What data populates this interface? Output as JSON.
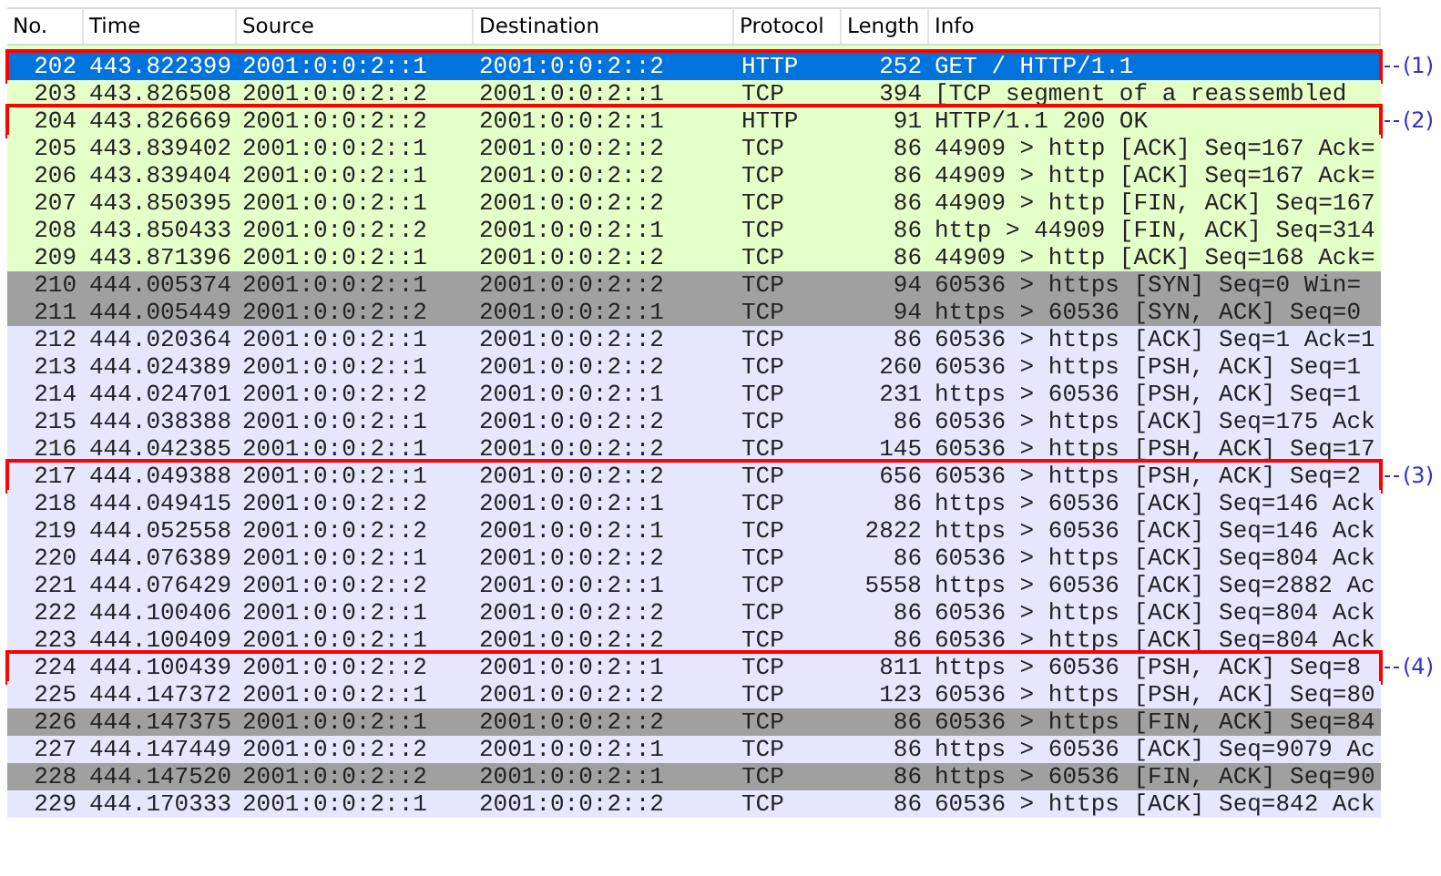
{
  "table": {
    "columns": [
      "No.",
      "Time",
      "Source",
      "Destination",
      "Protocol",
      "Length",
      "Info"
    ],
    "rows": [
      {
        "no": "202",
        "time": "443.822399",
        "source": "2001:0:0:2::1",
        "destination": "2001:0:0:2::2",
        "protocol": "HTTP",
        "length": "252",
        "info": "GET / HTTP/1.1",
        "selected": true,
        "callout": "(1)"
      },
      {
        "no": "203",
        "time": "443.826508",
        "source": "2001:0:0:2::2",
        "destination": "2001:0:0:2::1",
        "protocol": "TCP",
        "length": "394",
        "info": "[TCP segment of a reassembled",
        "color": "#e4ffc7",
        "selected": false
      },
      {
        "no": "204",
        "time": "443.826669",
        "source": "2001:0:0:2::2",
        "destination": "2001:0:0:2::1",
        "protocol": "HTTP",
        "length": "91",
        "info": "HTTP/1.1 200 OK",
        "color": "#e4ffc7",
        "selected": false,
        "callout": "(2)"
      },
      {
        "no": "205",
        "time": "443.839402",
        "source": "2001:0:0:2::1",
        "destination": "2001:0:0:2::2",
        "protocol": "TCP",
        "length": "86",
        "info": "44909 > http [ACK] Seq=167 Ack=",
        "color": "#e4ffc7",
        "selected": false
      },
      {
        "no": "206",
        "time": "443.839404",
        "source": "2001:0:0:2::1",
        "destination": "2001:0:0:2::2",
        "protocol": "TCP",
        "length": "86",
        "info": "44909 > http [ACK] Seq=167 Ack=",
        "color": "#e4ffc7",
        "selected": false
      },
      {
        "no": "207",
        "time": "443.850395",
        "source": "2001:0:0:2::1",
        "destination": "2001:0:0:2::2",
        "protocol": "TCP",
        "length": "86",
        "info": "44909 > http [FIN, ACK] Seq=167",
        "color": "#e4ffc7",
        "selected": false
      },
      {
        "no": "208",
        "time": "443.850433",
        "source": "2001:0:0:2::2",
        "destination": "2001:0:0:2::1",
        "protocol": "TCP",
        "length": "86",
        "info": "http > 44909 [FIN, ACK] Seq=314",
        "color": "#e4ffc7",
        "selected": false
      },
      {
        "no": "209",
        "time": "443.871396",
        "source": "2001:0:0:2::1",
        "destination": "2001:0:0:2::2",
        "protocol": "TCP",
        "length": "86",
        "info": "44909 > http [ACK] Seq=168 Ack=",
        "color": "#e4ffc7",
        "selected": false
      },
      {
        "no": "210",
        "time": "444.005374",
        "source": "2001:0:0:2::1",
        "destination": "2001:0:0:2::2",
        "protocol": "TCP",
        "length": "94",
        "info": "60536 > https [SYN] Seq=0 Win=",
        "color": "#a0a0a0",
        "selected": false
      },
      {
        "no": "211",
        "time": "444.005449",
        "source": "2001:0:0:2::2",
        "destination": "2001:0:0:2::1",
        "protocol": "TCP",
        "length": "94",
        "info": "https > 60536 [SYN, ACK] Seq=0",
        "color": "#a0a0a0",
        "selected": false
      },
      {
        "no": "212",
        "time": "444.020364",
        "source": "2001:0:0:2::1",
        "destination": "2001:0:0:2::2",
        "protocol": "TCP",
        "length": "86",
        "info": "60536 > https [ACK] Seq=1 Ack=1",
        "color": "#e7e6ff",
        "selected": false
      },
      {
        "no": "213",
        "time": "444.024389",
        "source": "2001:0:0:2::1",
        "destination": "2001:0:0:2::2",
        "protocol": "TCP",
        "length": "260",
        "info": "60536 > https [PSH, ACK] Seq=1",
        "color": "#e7e6ff",
        "selected": false
      },
      {
        "no": "214",
        "time": "444.024701",
        "source": "2001:0:0:2::2",
        "destination": "2001:0:0:2::1",
        "protocol": "TCP",
        "length": "231",
        "info": "https > 60536 [PSH, ACK] Seq=1",
        "color": "#e7e6ff",
        "selected": false
      },
      {
        "no": "215",
        "time": "444.038388",
        "source": "2001:0:0:2::1",
        "destination": "2001:0:0:2::2",
        "protocol": "TCP",
        "length": "86",
        "info": "60536 > https [ACK] Seq=175 Ack",
        "color": "#e7e6ff",
        "selected": false
      },
      {
        "no": "216",
        "time": "444.042385",
        "source": "2001:0:0:2::1",
        "destination": "2001:0:0:2::2",
        "protocol": "TCP",
        "length": "145",
        "info": "60536 > https [PSH, ACK] Seq=17",
        "color": "#e7e6ff",
        "selected": false
      },
      {
        "no": "217",
        "time": "444.049388",
        "source": "2001:0:0:2::1",
        "destination": "2001:0:0:2::2",
        "protocol": "TCP",
        "length": "656",
        "info": "60536 > https [PSH, ACK] Seq=2",
        "color": "#e7e6ff",
        "selected": false,
        "callout": "(3)"
      },
      {
        "no": "218",
        "time": "444.049415",
        "source": "2001:0:0:2::2",
        "destination": "2001:0:0:2::1",
        "protocol": "TCP",
        "length": "86",
        "info": "https > 60536 [ACK] Seq=146 Ack",
        "color": "#e7e6ff",
        "selected": false
      },
      {
        "no": "219",
        "time": "444.052558",
        "source": "2001:0:0:2::2",
        "destination": "2001:0:0:2::1",
        "protocol": "TCP",
        "length": "2822",
        "info": "https > 60536 [ACK] Seq=146 Ack",
        "color": "#e7e6ff",
        "selected": false
      },
      {
        "no": "220",
        "time": "444.076389",
        "source": "2001:0:0:2::1",
        "destination": "2001:0:0:2::2",
        "protocol": "TCP",
        "length": "86",
        "info": "60536 > https [ACK] Seq=804 Ack",
        "color": "#e7e6ff",
        "selected": false
      },
      {
        "no": "221",
        "time": "444.076429",
        "source": "2001:0:0:2::2",
        "destination": "2001:0:0:2::1",
        "protocol": "TCP",
        "length": "5558",
        "info": "https > 60536 [ACK] Seq=2882 Ac",
        "color": "#e7e6ff",
        "selected": false
      },
      {
        "no": "222",
        "time": "444.100406",
        "source": "2001:0:0:2::1",
        "destination": "2001:0:0:2::2",
        "protocol": "TCP",
        "length": "86",
        "info": "60536 > https [ACK] Seq=804 Ack",
        "color": "#e7e6ff",
        "selected": false
      },
      {
        "no": "223",
        "time": "444.100409",
        "source": "2001:0:0:2::1",
        "destination": "2001:0:0:2::2",
        "protocol": "TCP",
        "length": "86",
        "info": "60536 > https [ACK] Seq=804 Ack",
        "color": "#e7e6ff",
        "selected": false
      },
      {
        "no": "224",
        "time": "444.100439",
        "source": "2001:0:0:2::2",
        "destination": "2001:0:0:2::1",
        "protocol": "TCP",
        "length": "811",
        "info": "https > 60536 [PSH, ACK] Seq=8",
        "color": "#e7e6ff",
        "selected": false,
        "callout": "(4)"
      },
      {
        "no": "225",
        "time": "444.147372",
        "source": "2001:0:0:2::1",
        "destination": "2001:0:0:2::2",
        "protocol": "TCP",
        "length": "123",
        "info": "60536 > https [PSH, ACK] Seq=80",
        "color": "#e7e6ff",
        "selected": false
      },
      {
        "no": "226",
        "time": "444.147375",
        "source": "2001:0:0:2::1",
        "destination": "2001:0:0:2::2",
        "protocol": "TCP",
        "length": "86",
        "info": "60536 > https [FIN, ACK] Seq=84",
        "color": "#a0a0a0",
        "selected": false
      },
      {
        "no": "227",
        "time": "444.147449",
        "source": "2001:0:0:2::2",
        "destination": "2001:0:0:2::1",
        "protocol": "TCP",
        "length": "86",
        "info": "https > 60536 [ACK] Seq=9079 Ac",
        "color": "#e7e6ff",
        "selected": false
      },
      {
        "no": "228",
        "time": "444.147520",
        "source": "2001:0:0:2::2",
        "destination": "2001:0:0:2::1",
        "protocol": "TCP",
        "length": "86",
        "info": "https > 60536 [FIN, ACK] Seq=90",
        "color": "#a0a0a0",
        "selected": false
      },
      {
        "no": "229",
        "time": "444.170333",
        "source": "2001:0:0:2::1",
        "destination": "2001:0:0:2::2",
        "protocol": "TCP",
        "length": "86",
        "info": "60536 > https [ACK] Seq=842 Ack",
        "color": "#e7e6ff",
        "selected": false
      }
    ]
  }
}
